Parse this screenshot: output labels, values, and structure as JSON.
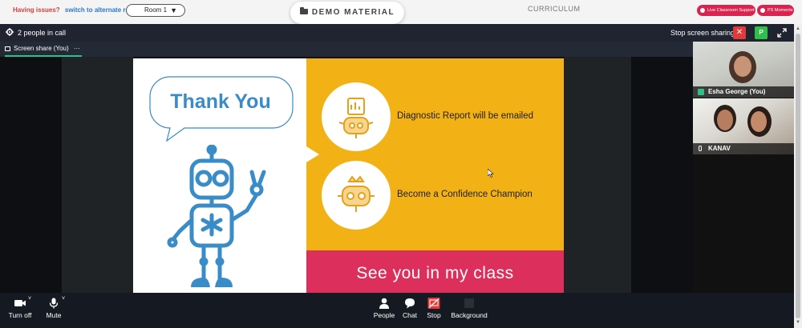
{
  "top": {
    "issues_text": "Having issues?",
    "alternate_link": "switch to alternate room",
    "room_selected": "Room 1",
    "demo_button": "DEMO MATERIAL",
    "curriculum_link": "CURRICULUM",
    "live_support": "Live Classroom Support",
    "ps_moments": "PS Moments"
  },
  "call": {
    "people_count": "2 people in call",
    "stop_sharing": "Stop screen sharing",
    "p_badge": "P",
    "tab_label": "Screen share (You)",
    "tab_menu": "···"
  },
  "slide": {
    "bubble_title": "Thank You",
    "item1": "Diagnostic Report will be emailed",
    "item2": "Become a Confidence Champion",
    "footer": "See you in my class"
  },
  "participants": [
    {
      "name": "Esha George (You)"
    },
    {
      "name": "KANAV"
    }
  ],
  "controls": {
    "turn_off": "Turn off",
    "mute": "Mute",
    "people": "People",
    "chat": "Chat",
    "stop": "Stop",
    "background": "Background"
  },
  "colors": {
    "accent_red": "#d9244f",
    "slide_yellow": "#f2b215",
    "slide_pink": "#dc2f5c",
    "robot_blue": "#3a8cc8",
    "green": "#2fc04a"
  }
}
